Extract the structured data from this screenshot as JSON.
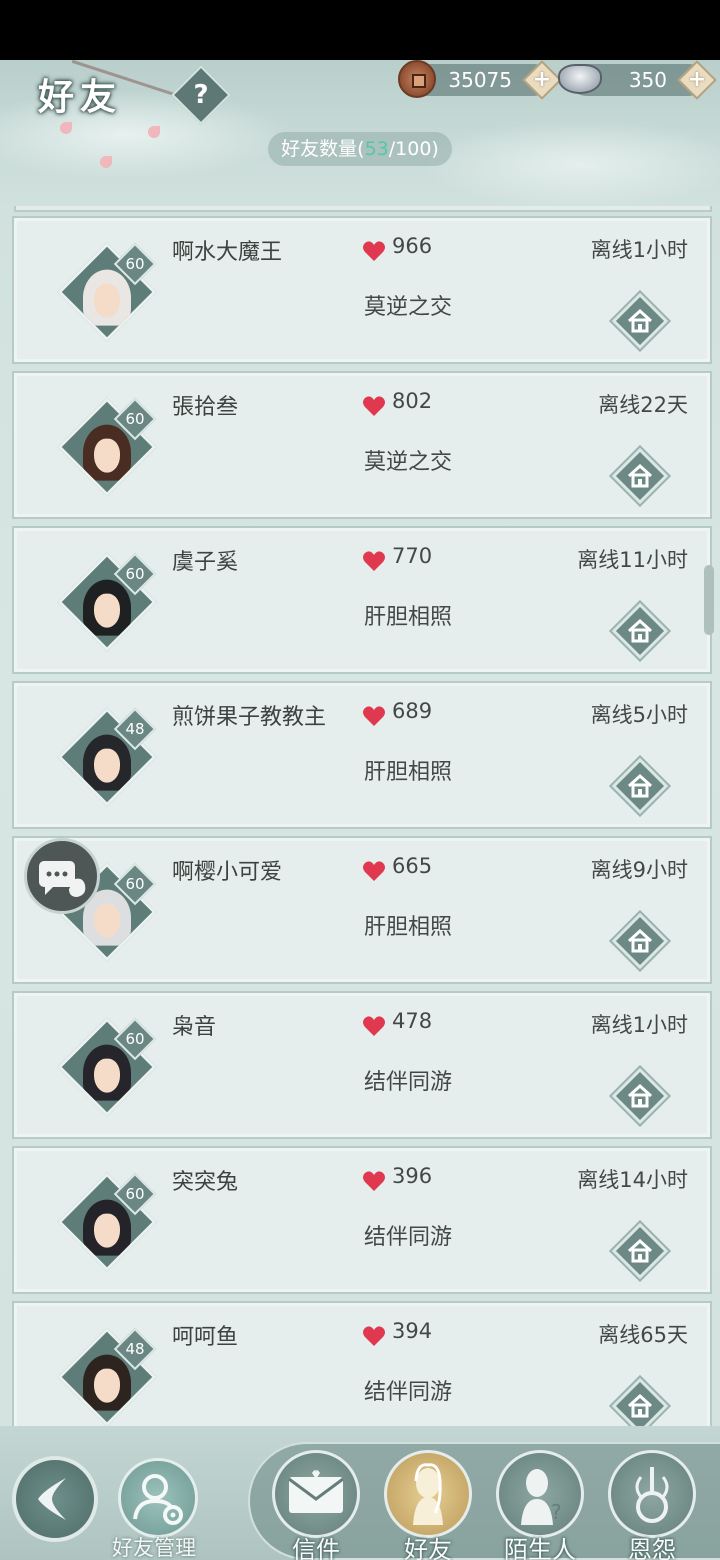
{
  "header": {
    "title": "好友",
    "help_icon": "question-mark-icon",
    "copper_coins": "35075",
    "silver": "350",
    "friend_count_label": "好友数量(",
    "friend_count_current": "53",
    "friend_count_max": "/100)"
  },
  "friends": [
    {
      "name": "啊水大魔王",
      "level": "60",
      "intimacy": "966",
      "relation": "莫逆之交",
      "offline": "离线1小时",
      "hair": "#e9e6e4"
    },
    {
      "name": "張拾叁",
      "level": "60",
      "intimacy": "802",
      "relation": "莫逆之交",
      "offline": "离线22天",
      "hair": "#4a2d22"
    },
    {
      "name": "虞子奚",
      "level": "60",
      "intimacy": "770",
      "relation": "肝胆相照",
      "offline": "离线11小时",
      "hair": "#1f2022"
    },
    {
      "name": "煎饼果子教教主",
      "level": "48",
      "intimacy": "689",
      "relation": "肝胆相照",
      "offline": "离线5小时",
      "hair": "#26272b"
    },
    {
      "name": "啊樱小可爱",
      "level": "60",
      "intimacy": "665",
      "relation": "肝胆相照",
      "offline": "离线9小时",
      "hair": "#dcdedf"
    },
    {
      "name": "枭音",
      "level": "60",
      "intimacy": "478",
      "relation": "结伴同游",
      "offline": "离线1小时",
      "hair": "#25252b"
    },
    {
      "name": "突突兔",
      "level": "60",
      "intimacy": "396",
      "relation": "结伴同游",
      "offline": "离线14小时",
      "hair": "#232329"
    },
    {
      "name": "呵呵鱼",
      "level": "48",
      "intimacy": "394",
      "relation": "结伴同游",
      "offline": "离线65天",
      "hair": "#2e241f"
    }
  ],
  "bottom_nav": {
    "manage_label": "好友管理",
    "tabs": [
      {
        "label": "信件",
        "icon": "envelope-icon"
      },
      {
        "label": "好友",
        "icon": "female-figure-icon",
        "active": true
      },
      {
        "label": "陌生人",
        "icon": "stranger-figure-icon"
      },
      {
        "label": "恩怨",
        "icon": "hookah-icon"
      }
    ]
  },
  "colors": {
    "accent_count": "#57c7a3",
    "heart": "#e0394f",
    "panel": "#e5eeec",
    "border": "#b6cac6"
  }
}
